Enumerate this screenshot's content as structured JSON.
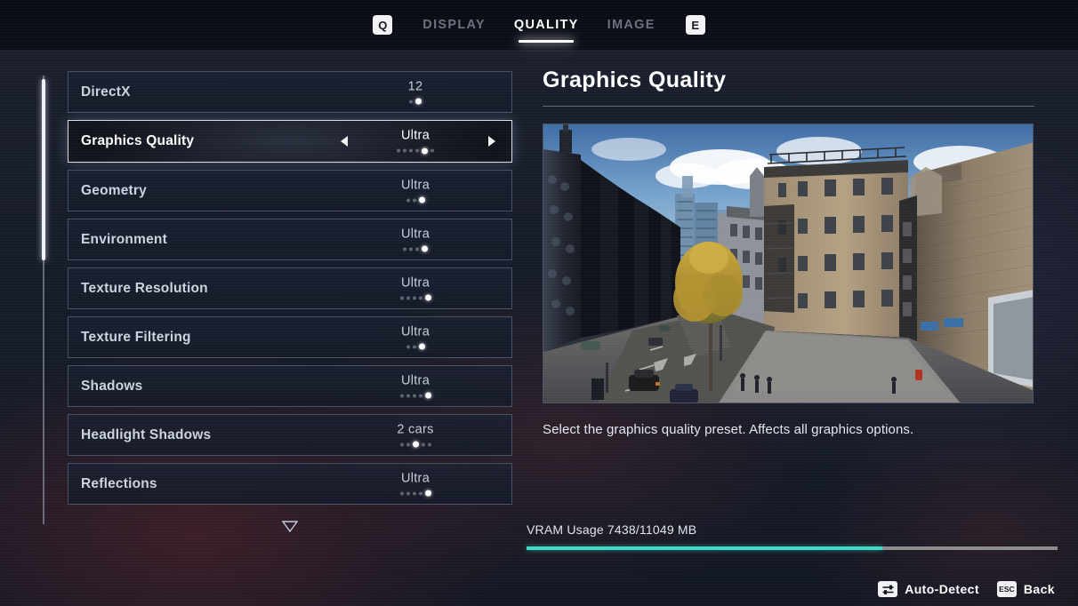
{
  "header": {
    "left_key": "Q",
    "right_key": "E",
    "tabs": [
      {
        "label": "DISPLAY",
        "active": false
      },
      {
        "label": "QUALITY",
        "active": true
      },
      {
        "label": "IMAGE",
        "active": false
      }
    ]
  },
  "settings_list": {
    "scroll_more_icon": "chevron-down-icon",
    "rows": [
      {
        "label": "DirectX",
        "value": "12",
        "dots_total": 2,
        "dots_index": 2,
        "selected": false
      },
      {
        "label": "Graphics Quality",
        "value": "Ultra",
        "dots_total": 6,
        "dots_index": 5,
        "selected": true
      },
      {
        "label": "Geometry",
        "value": "Ultra",
        "dots_total": 3,
        "dots_index": 3,
        "selected": false
      },
      {
        "label": "Environment",
        "value": "Ultra",
        "dots_total": 4,
        "dots_index": 4,
        "selected": false
      },
      {
        "label": "Texture Resolution",
        "value": "Ultra",
        "dots_total": 5,
        "dots_index": 5,
        "selected": false
      },
      {
        "label": "Texture Filtering",
        "value": "Ultra",
        "dots_total": 3,
        "dots_index": 3,
        "selected": false
      },
      {
        "label": "Shadows",
        "value": "Ultra",
        "dots_total": 5,
        "dots_index": 5,
        "selected": false
      },
      {
        "label": "Headlight Shadows",
        "value": "2 cars",
        "dots_total": 5,
        "dots_index": 3,
        "selected": false
      },
      {
        "label": "Reflections",
        "value": "Ultra",
        "dots_total": 5,
        "dots_index": 5,
        "selected": false
      }
    ]
  },
  "detail_panel": {
    "title": "Graphics Quality",
    "description": "Select the graphics quality preset. Affects all graphics options.",
    "preview_alt": "city street preview"
  },
  "vram": {
    "label": "VRAM Usage 7438/11049 MB",
    "used_mb": 7438,
    "total_mb": 11049,
    "percent": 67,
    "fill_color": "#3fdac8",
    "track_color": "#8c8c8c"
  },
  "footer": {
    "buttons": [
      {
        "key_icon": "sliders-icon",
        "key_text": "",
        "label": "Auto-Detect"
      },
      {
        "key_icon": "esc-key-icon",
        "key_text": "ESC",
        "label": "Back"
      }
    ]
  },
  "colors": {
    "accent_white": "#ffffff",
    "muted_text": "#6c7180",
    "row_text": "#ccd2e0",
    "teal": "#3fdac8"
  }
}
